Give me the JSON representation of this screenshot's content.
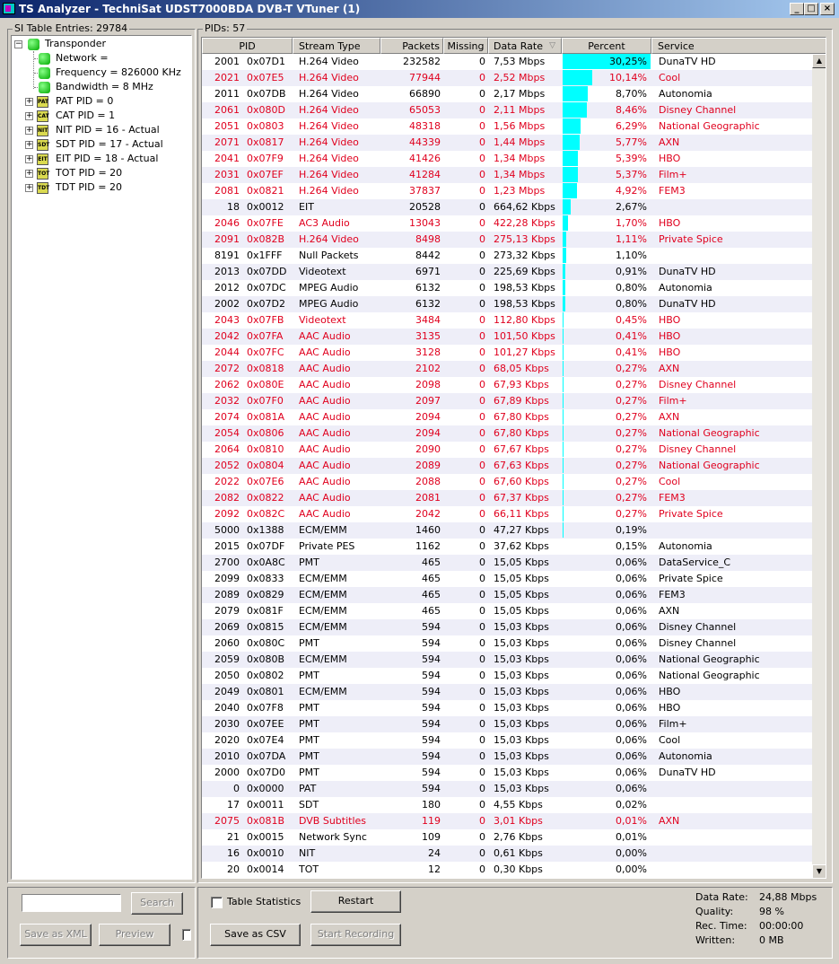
{
  "window": {
    "title": "TS Analyzer - TechniSat UDST7000BDA DVB-T VTuner (1)",
    "minimize": "_",
    "maximize": "□",
    "close": "×"
  },
  "si_panel": {
    "label": "SI Table Entries: 29784",
    "tree": {
      "root": "Transponder",
      "children": [
        "Network =",
        "Frequency = 826000 KHz",
        "Bandwidth = 8 MHz"
      ],
      "tables": [
        {
          "label": "PAT PID = 0",
          "icon": "PAT"
        },
        {
          "label": "CAT PID = 1",
          "icon": "CAT"
        },
        {
          "label": "NIT PID = 16 - Actual",
          "icon": "NIT"
        },
        {
          "label": "SDT PID = 17 - Actual",
          "icon": "SDT"
        },
        {
          "label": "EIT PID = 18 - Actual",
          "icon": "EIT"
        },
        {
          "label": "TOT PID = 20",
          "icon": "TOT"
        },
        {
          "label": "TDT PID = 20",
          "icon": "TDT"
        }
      ]
    },
    "search_value": "",
    "search_button": "Search",
    "save_xml_button": "Save as XML",
    "preview_button": "Preview"
  },
  "pids_panel": {
    "label": "PIDs: 57",
    "columns": [
      "PID",
      "Stream Type",
      "Packets",
      "Missing",
      "Data Rate",
      "Percent",
      "Service"
    ],
    "sort_indicator": "▽",
    "rows": [
      {
        "pid": "2001",
        "hex": "0x07D1",
        "type": "H.264 Video",
        "packets": "232582",
        "missing": "0",
        "rate": "7,53 Mbps",
        "percent": "30,25%",
        "pct": 30.25,
        "service": "DunaTV HD",
        "red": false
      },
      {
        "pid": "2021",
        "hex": "0x07E5",
        "type": "H.264 Video",
        "packets": "77944",
        "missing": "0",
        "rate": "2,52 Mbps",
        "percent": "10,14%",
        "pct": 10.14,
        "service": "Cool",
        "red": true
      },
      {
        "pid": "2011",
        "hex": "0x07DB",
        "type": "H.264 Video",
        "packets": "66890",
        "missing": "0",
        "rate": "2,17 Mbps",
        "percent": "8,70%",
        "pct": 8.7,
        "service": "Autonomia",
        "red": false
      },
      {
        "pid": "2061",
        "hex": "0x080D",
        "type": "H.264 Video",
        "packets": "65053",
        "missing": "0",
        "rate": "2,11 Mbps",
        "percent": "8,46%",
        "pct": 8.46,
        "service": "Disney Channel",
        "red": true
      },
      {
        "pid": "2051",
        "hex": "0x0803",
        "type": "H.264 Video",
        "packets": "48318",
        "missing": "0",
        "rate": "1,56 Mbps",
        "percent": "6,29%",
        "pct": 6.29,
        "service": "National Geographic",
        "red": true
      },
      {
        "pid": "2071",
        "hex": "0x0817",
        "type": "H.264 Video",
        "packets": "44339",
        "missing": "0",
        "rate": "1,44 Mbps",
        "percent": "5,77%",
        "pct": 5.77,
        "service": "AXN",
        "red": true
      },
      {
        "pid": "2041",
        "hex": "0x07F9",
        "type": "H.264 Video",
        "packets": "41426",
        "missing": "0",
        "rate": "1,34 Mbps",
        "percent": "5,39%",
        "pct": 5.39,
        "service": "HBO",
        "red": true
      },
      {
        "pid": "2031",
        "hex": "0x07EF",
        "type": "H.264 Video",
        "packets": "41284",
        "missing": "0",
        "rate": "1,34 Mbps",
        "percent": "5,37%",
        "pct": 5.37,
        "service": "Film+",
        "red": true
      },
      {
        "pid": "2081",
        "hex": "0x0821",
        "type": "H.264 Video",
        "packets": "37837",
        "missing": "0",
        "rate": "1,23 Mbps",
        "percent": "4,92%",
        "pct": 4.92,
        "service": "FEM3",
        "red": true
      },
      {
        "pid": "18",
        "hex": "0x0012",
        "type": "EIT",
        "packets": "20528",
        "missing": "0",
        "rate": "664,62 Kbps",
        "percent": "2,67%",
        "pct": 2.67,
        "service": "",
        "red": false
      },
      {
        "pid": "2046",
        "hex": "0x07FE",
        "type": "AC3 Audio",
        "packets": "13043",
        "missing": "0",
        "rate": "422,28 Kbps",
        "percent": "1,70%",
        "pct": 1.7,
        "service": "HBO",
        "red": true
      },
      {
        "pid": "2091",
        "hex": "0x082B",
        "type": "H.264 Video",
        "packets": "8498",
        "missing": "0",
        "rate": "275,13 Kbps",
        "percent": "1,11%",
        "pct": 1.11,
        "service": "Private Spice",
        "red": true
      },
      {
        "pid": "8191",
        "hex": "0x1FFF",
        "type": "Null Packets",
        "packets": "8442",
        "missing": "0",
        "rate": "273,32 Kbps",
        "percent": "1,10%",
        "pct": 1.1,
        "service": "",
        "red": false
      },
      {
        "pid": "2013",
        "hex": "0x07DD",
        "type": "Videotext",
        "packets": "6971",
        "missing": "0",
        "rate": "225,69 Kbps",
        "percent": "0,91%",
        "pct": 0.91,
        "service": "DunaTV HD",
        "red": false
      },
      {
        "pid": "2012",
        "hex": "0x07DC",
        "type": "MPEG Audio",
        "packets": "6132",
        "missing": "0",
        "rate": "198,53 Kbps",
        "percent": "0,80%",
        "pct": 0.8,
        "service": "Autonomia",
        "red": false
      },
      {
        "pid": "2002",
        "hex": "0x07D2",
        "type": "MPEG Audio",
        "packets": "6132",
        "missing": "0",
        "rate": "198,53 Kbps",
        "percent": "0,80%",
        "pct": 0.8,
        "service": "DunaTV HD",
        "red": false
      },
      {
        "pid": "2043",
        "hex": "0x07FB",
        "type": "Videotext",
        "packets": "3484",
        "missing": "0",
        "rate": "112,80 Kbps",
        "percent": "0,45%",
        "pct": 0.45,
        "service": "HBO",
        "red": true
      },
      {
        "pid": "2042",
        "hex": "0x07FA",
        "type": "AAC Audio",
        "packets": "3135",
        "missing": "0",
        "rate": "101,50 Kbps",
        "percent": "0,41%",
        "pct": 0.41,
        "service": "HBO",
        "red": true
      },
      {
        "pid": "2044",
        "hex": "0x07FC",
        "type": "AAC Audio",
        "packets": "3128",
        "missing": "0",
        "rate": "101,27 Kbps",
        "percent": "0,41%",
        "pct": 0.41,
        "service": "HBO",
        "red": true
      },
      {
        "pid": "2072",
        "hex": "0x0818",
        "type": "AAC Audio",
        "packets": "2102",
        "missing": "0",
        "rate": "68,05 Kbps",
        "percent": "0,27%",
        "pct": 0.27,
        "service": "AXN",
        "red": true
      },
      {
        "pid": "2062",
        "hex": "0x080E",
        "type": "AAC Audio",
        "packets": "2098",
        "missing": "0",
        "rate": "67,93 Kbps",
        "percent": "0,27%",
        "pct": 0.27,
        "service": "Disney Channel",
        "red": true
      },
      {
        "pid": "2032",
        "hex": "0x07F0",
        "type": "AAC Audio",
        "packets": "2097",
        "missing": "0",
        "rate": "67,89 Kbps",
        "percent": "0,27%",
        "pct": 0.27,
        "service": "Film+",
        "red": true
      },
      {
        "pid": "2074",
        "hex": "0x081A",
        "type": "AAC Audio",
        "packets": "2094",
        "missing": "0",
        "rate": "67,80 Kbps",
        "percent": "0,27%",
        "pct": 0.27,
        "service": "AXN",
        "red": true
      },
      {
        "pid": "2054",
        "hex": "0x0806",
        "type": "AAC Audio",
        "packets": "2094",
        "missing": "0",
        "rate": "67,80 Kbps",
        "percent": "0,27%",
        "pct": 0.27,
        "service": "National Geographic",
        "red": true
      },
      {
        "pid": "2064",
        "hex": "0x0810",
        "type": "AAC Audio",
        "packets": "2090",
        "missing": "0",
        "rate": "67,67 Kbps",
        "percent": "0,27%",
        "pct": 0.27,
        "service": "Disney Channel",
        "red": true
      },
      {
        "pid": "2052",
        "hex": "0x0804",
        "type": "AAC Audio",
        "packets": "2089",
        "missing": "0",
        "rate": "67,63 Kbps",
        "percent": "0,27%",
        "pct": 0.27,
        "service": "National Geographic",
        "red": true
      },
      {
        "pid": "2022",
        "hex": "0x07E6",
        "type": "AAC Audio",
        "packets": "2088",
        "missing": "0",
        "rate": "67,60 Kbps",
        "percent": "0,27%",
        "pct": 0.27,
        "service": "Cool",
        "red": true
      },
      {
        "pid": "2082",
        "hex": "0x0822",
        "type": "AAC Audio",
        "packets": "2081",
        "missing": "0",
        "rate": "67,37 Kbps",
        "percent": "0,27%",
        "pct": 0.27,
        "service": "FEM3",
        "red": true
      },
      {
        "pid": "2092",
        "hex": "0x082C",
        "type": "AAC Audio",
        "packets": "2042",
        "missing": "0",
        "rate": "66,11 Kbps",
        "percent": "0,27%",
        "pct": 0.27,
        "service": "Private Spice",
        "red": true
      },
      {
        "pid": "5000",
        "hex": "0x1388",
        "type": "ECM/EMM",
        "packets": "1460",
        "missing": "0",
        "rate": "47,27 Kbps",
        "percent": "0,19%",
        "pct": 0.19,
        "service": "",
        "red": false
      },
      {
        "pid": "2015",
        "hex": "0x07DF",
        "type": "Private PES",
        "packets": "1162",
        "missing": "0",
        "rate": "37,62 Kbps",
        "percent": "0,15%",
        "pct": 0.15,
        "service": "Autonomia",
        "red": false
      },
      {
        "pid": "2700",
        "hex": "0x0A8C",
        "type": "PMT",
        "packets": "465",
        "missing": "0",
        "rate": "15,05 Kbps",
        "percent": "0,06%",
        "pct": 0.06,
        "service": "DataService_C",
        "red": false
      },
      {
        "pid": "2099",
        "hex": "0x0833",
        "type": "ECM/EMM",
        "packets": "465",
        "missing": "0",
        "rate": "15,05 Kbps",
        "percent": "0,06%",
        "pct": 0.06,
        "service": "Private Spice",
        "red": false
      },
      {
        "pid": "2089",
        "hex": "0x0829",
        "type": "ECM/EMM",
        "packets": "465",
        "missing": "0",
        "rate": "15,05 Kbps",
        "percent": "0,06%",
        "pct": 0.06,
        "service": "FEM3",
        "red": false
      },
      {
        "pid": "2079",
        "hex": "0x081F",
        "type": "ECM/EMM",
        "packets": "465",
        "missing": "0",
        "rate": "15,05 Kbps",
        "percent": "0,06%",
        "pct": 0.06,
        "service": "AXN",
        "red": false
      },
      {
        "pid": "2069",
        "hex": "0x0815",
        "type": "ECM/EMM",
        "packets": "594",
        "missing": "0",
        "rate": "15,03 Kbps",
        "percent": "0,06%",
        "pct": 0.06,
        "service": "Disney Channel",
        "red": false
      },
      {
        "pid": "2060",
        "hex": "0x080C",
        "type": "PMT",
        "packets": "594",
        "missing": "0",
        "rate": "15,03 Kbps",
        "percent": "0,06%",
        "pct": 0.06,
        "service": "Disney Channel",
        "red": false
      },
      {
        "pid": "2059",
        "hex": "0x080B",
        "type": "ECM/EMM",
        "packets": "594",
        "missing": "0",
        "rate": "15,03 Kbps",
        "percent": "0,06%",
        "pct": 0.06,
        "service": "National Geographic",
        "red": false
      },
      {
        "pid": "2050",
        "hex": "0x0802",
        "type": "PMT",
        "packets": "594",
        "missing": "0",
        "rate": "15,03 Kbps",
        "percent": "0,06%",
        "pct": 0.06,
        "service": "National Geographic",
        "red": false
      },
      {
        "pid": "2049",
        "hex": "0x0801",
        "type": "ECM/EMM",
        "packets": "594",
        "missing": "0",
        "rate": "15,03 Kbps",
        "percent": "0,06%",
        "pct": 0.06,
        "service": "HBO",
        "red": false
      },
      {
        "pid": "2040",
        "hex": "0x07F8",
        "type": "PMT",
        "packets": "594",
        "missing": "0",
        "rate": "15,03 Kbps",
        "percent": "0,06%",
        "pct": 0.06,
        "service": "HBO",
        "red": false
      },
      {
        "pid": "2030",
        "hex": "0x07EE",
        "type": "PMT",
        "packets": "594",
        "missing": "0",
        "rate": "15,03 Kbps",
        "percent": "0,06%",
        "pct": 0.06,
        "service": "Film+",
        "red": false
      },
      {
        "pid": "2020",
        "hex": "0x07E4",
        "type": "PMT",
        "packets": "594",
        "missing": "0",
        "rate": "15,03 Kbps",
        "percent": "0,06%",
        "pct": 0.06,
        "service": "Cool",
        "red": false
      },
      {
        "pid": "2010",
        "hex": "0x07DA",
        "type": "PMT",
        "packets": "594",
        "missing": "0",
        "rate": "15,03 Kbps",
        "percent": "0,06%",
        "pct": 0.06,
        "service": "Autonomia",
        "red": false
      },
      {
        "pid": "2000",
        "hex": "0x07D0",
        "type": "PMT",
        "packets": "594",
        "missing": "0",
        "rate": "15,03 Kbps",
        "percent": "0,06%",
        "pct": 0.06,
        "service": "DunaTV HD",
        "red": false
      },
      {
        "pid": "0",
        "hex": "0x0000",
        "type": "PAT",
        "packets": "594",
        "missing": "0",
        "rate": "15,03 Kbps",
        "percent": "0,06%",
        "pct": 0.06,
        "service": "",
        "red": false
      },
      {
        "pid": "17",
        "hex": "0x0011",
        "type": "SDT",
        "packets": "180",
        "missing": "0",
        "rate": "4,55 Kbps",
        "percent": "0,02%",
        "pct": 0.02,
        "service": "",
        "red": false
      },
      {
        "pid": "2075",
        "hex": "0x081B",
        "type": "DVB Subtitles",
        "packets": "119",
        "missing": "0",
        "rate": "3,01 Kbps",
        "percent": "0,01%",
        "pct": 0.01,
        "service": "AXN",
        "red": true
      },
      {
        "pid": "21",
        "hex": "0x0015",
        "type": "Network Sync",
        "packets": "109",
        "missing": "0",
        "rate": "2,76 Kbps",
        "percent": "0,01%",
        "pct": 0.01,
        "service": "",
        "red": false
      },
      {
        "pid": "16",
        "hex": "0x0010",
        "type": "NIT",
        "packets": "24",
        "missing": "0",
        "rate": "0,61 Kbps",
        "percent": "0,00%",
        "pct": 0.0,
        "service": "",
        "red": false
      },
      {
        "pid": "20",
        "hex": "0x0014",
        "type": "TOT",
        "packets": "12",
        "missing": "0",
        "rate": "0,30 Kbps",
        "percent": "0,00%",
        "pct": 0.0,
        "service": "",
        "red": false
      }
    ]
  },
  "controls": {
    "table_statistics_label": "Table Statistics",
    "restart_button": "Restart",
    "save_csv_button": "Save as CSV",
    "start_recording_button": "Start Recording"
  },
  "stats": {
    "data_rate_label": "Data Rate:",
    "data_rate_value": "24,88 Mbps",
    "quality_label": "Quality:",
    "quality_value": "98 %",
    "rec_time_label": "Rec. Time:",
    "rec_time_value": "00:00:00",
    "written_label": "Written:",
    "written_value": "0 MB"
  },
  "colors": {
    "bar": "#00ffff",
    "red_text": "#e0001e",
    "alt_row": "#eeeef8"
  }
}
